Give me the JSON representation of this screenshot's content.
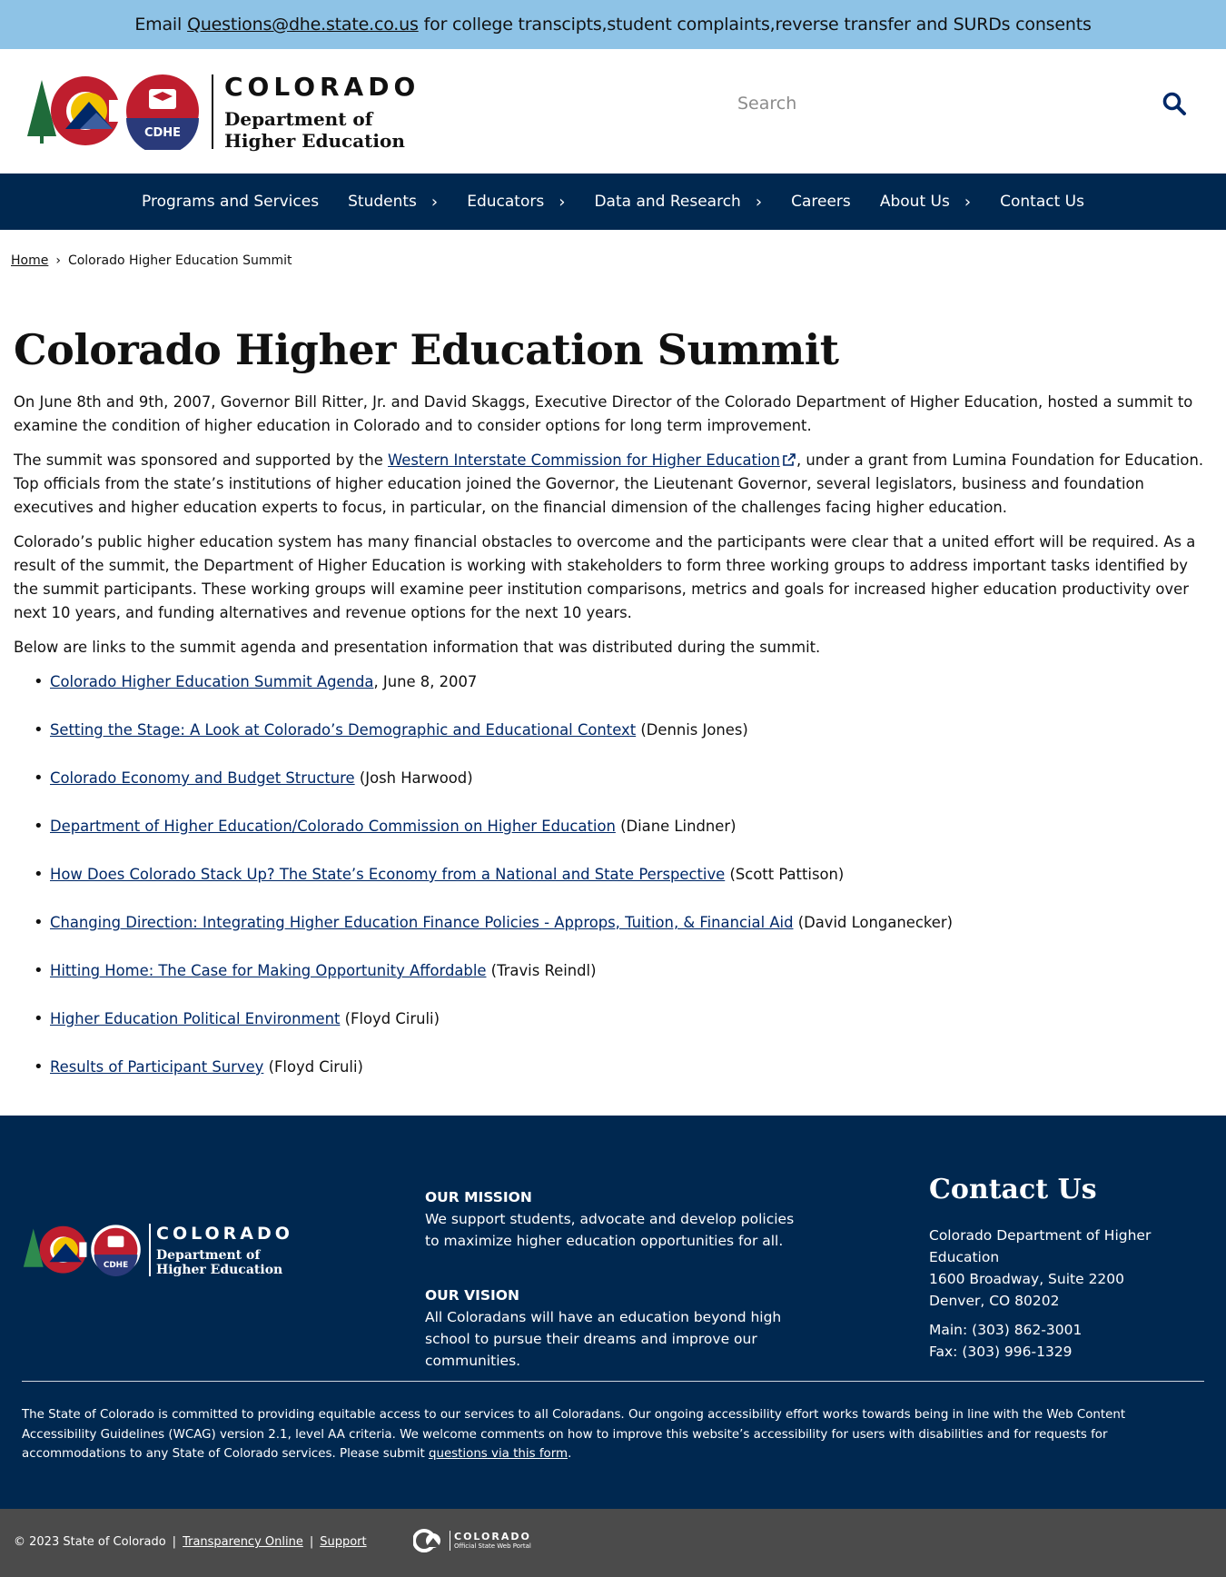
{
  "alert": {
    "prefix": "Email",
    "email": "Questions@dhe.state.co.us",
    "suffix": "for college transcipts,student complaints,reverse transfer and SURDs consents"
  },
  "header": {
    "logo_state": "COLORADO",
    "logo_dept_line1": "Department of",
    "logo_dept_line2": "Higher Education",
    "logo_badge": "CDHE",
    "search_placeholder": "Search"
  },
  "nav": {
    "items": [
      {
        "label": "Programs and Services",
        "has_children": false
      },
      {
        "label": "Students",
        "has_children": true
      },
      {
        "label": "Educators",
        "has_children": true
      },
      {
        "label": "Data and Research",
        "has_children": true
      },
      {
        "label": "Careers",
        "has_children": false
      },
      {
        "label": "About Us",
        "has_children": true
      },
      {
        "label": "Contact Us",
        "has_children": false
      }
    ]
  },
  "breadcrumb": {
    "home": "Home",
    "separator": "›",
    "current": "Colorado Higher Education Summit"
  },
  "main": {
    "title": "Colorado Higher Education Summit",
    "p1": "On June 8th and 9th, 2007, Governor Bill Ritter, Jr. and David Skaggs, Executive Director of the Colorado Department of Higher Education, hosted a summit to examine the condition of higher education in Colorado and to consider options for long term improvement.",
    "p2_before": "The summit was sponsored and supported by the ",
    "p2_link": "Western Interstate Commission for Higher Education",
    "p2_after": ", under a grant from Lumina Foundation for Education. Top officials from the state’s institutions of higher education joined the Governor, the Lieutenant Governor, several legislators, business and foundation executives and higher education experts to focus, in particular, on the financial dimension of the challenges facing higher education.",
    "p3": "Colorado’s public higher education system has many financial obstacles to overcome and the participants were clear that a united effort will be required. As a result of the summit, the Department of Higher Education is working with stakeholders to form three working groups to address important tasks identified by the summit participants. These working groups will examine peer institution comparisons, metrics and goals for increased higher education productivity over next 10 years, and funding alternatives and revenue options for the next 10 years.",
    "p4": "Below are links to the summit agenda and presentation information that was distributed during the summit.",
    "links": [
      {
        "text": "Colorado Higher Education Summit Agenda",
        "suffix": ", June 8, 2007"
      },
      {
        "text": "Setting the Stage: A Look at Colorado’s Demographic and Educational Context",
        "suffix": " (Dennis Jones)"
      },
      {
        "text": "Colorado Economy and Budget Structure",
        "suffix": " (Josh Harwood)"
      },
      {
        "text": "Department of Higher Education/Colorado Commission on Higher Education",
        "suffix": " (Diane Lindner)"
      },
      {
        "text": "How Does Colorado Stack Up? The State’s Economy from a National and State Perspective",
        "suffix": " (Scott Pattison)"
      },
      {
        "text": "Changing Direction: Integrating Higher Education Finance Policies - Approps, Tuition, & Financial Aid",
        "suffix": " (David Longanecker)"
      },
      {
        "text": "Hitting Home: The Case for Making Opportunity Affordable",
        "suffix": " (Travis Reindl)"
      },
      {
        "text": "Higher Education Political Environment",
        "suffix": " (Floyd Ciruli)"
      },
      {
        "text": "Results of Participant Survey",
        "suffix": " (Floyd Ciruli)"
      }
    ]
  },
  "footer": {
    "logo_state": "COLORADO",
    "logo_dept_line1": "Department of",
    "logo_dept_line2": "Higher Education",
    "logo_badge": "CDHE",
    "mission_heading": "OUR MISSION",
    "mission_text": "We support students, advocate and develop policies to maximize higher education opportunities for all.",
    "vision_heading": "OUR VISION",
    "vision_text": "All Coloradans will have an education beyond high school to pursue their dreams and improve our communities.",
    "contact_heading": "Contact Us",
    "contact_org": "Colorado Department of Higher Education",
    "contact_addr1": "1600 Broadway, Suite 2200",
    "contact_addr2": "Denver, CO 80202",
    "contact_main": "Main: (303) 862-3001",
    "contact_fax": "Fax: (303) 996-1329",
    "access_text": "The State of Colorado is committed to providing equitable access to our services to all Coloradans. Our ongoing accessibility effort works towards being in line with the Web Content Accessibility Guidelines (WCAG) version 2.1, level AA criteria. We welcome comments on how to improve this website’s accessibility for users with disabilities and for requests for accommodations to any State of Colorado services. Please submit ",
    "access_link": "questions via this form",
    "access_end": "."
  },
  "bottom": {
    "copyright": "© 2023 State of Colorado",
    "sep": "|",
    "transparency": "Transparency Online",
    "support": "Support",
    "portal_state": "COLORADO",
    "portal_sub": "Official State Web Portal"
  },
  "colors": {
    "alert_bg": "#8ec3e6",
    "nav_bg": "#002850",
    "footer_bg": "#002850",
    "bottom_bg": "#4b4b4b",
    "link": "#002868"
  }
}
